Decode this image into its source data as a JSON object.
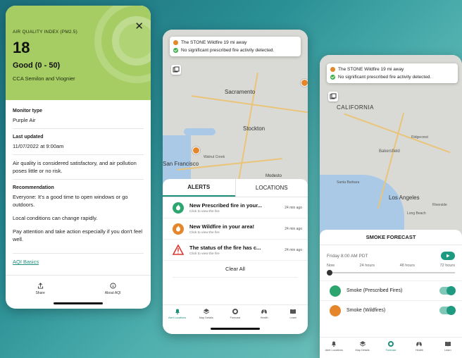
{
  "colors": {
    "aqi_good": "#a6cd64",
    "accent": "#1e8f7b",
    "fire": "#e6862a",
    "ok": "#3cae4a",
    "warning": "#d9382f"
  },
  "aqi_screen": {
    "index_label": "AIR QUALITY INDEX (PM2.5)",
    "value": "18",
    "status": "Good (0 - 50)",
    "station": "CCA Semilon and Viognier",
    "close_icon": "close-icon",
    "monitor_type_label": "Monitor type",
    "monitor_type_value": "Purple Air",
    "last_updated_label": "Last updated",
    "last_updated_value": "11/07/2022 at 9:00am",
    "description": "Air quality is considered satisfactory, and air pollution poses little or no risk.",
    "recommendation_label": "Recommendation",
    "recommendation_p1": "Everyone: It's a good time to open windows or go outdoors.",
    "recommendation_p2": "Local conditions can change rapidly.",
    "recommendation_p3": "Pay attention and take action especially if you don't feel well.",
    "aqi_basics_link": "AQI Basics",
    "footer": {
      "share_label": "Share",
      "about_label": "About AQI"
    }
  },
  "alerts_screen": {
    "banner_fire": "The STONE Wildfire 19 mi away",
    "banner_prescribed": "No significant prescribed fire activity detected.",
    "map_labels": {
      "sacramento": "Sacramento",
      "stockton": "Stockton",
      "san_francisco": "San Francisco",
      "modesto": "Modesto",
      "walnut_creek": "Walnut Creek"
    },
    "tabs": {
      "alerts": "ALERTS",
      "locations": "LOCATIONS"
    },
    "alerts": [
      {
        "title": "New Prescribed fire in your...",
        "subtitle": "Click to view the fire",
        "time": "24 min ago",
        "icon": "prescribed-fire-icon"
      },
      {
        "title": "New Wildfire in your area!",
        "subtitle": "Click to view the fire",
        "time": "24 min ago",
        "icon": "wildfire-icon"
      },
      {
        "title": "The status of the fire has c...",
        "subtitle": "Click to view the fire",
        "time": "24 min ago",
        "icon": "warning-icon"
      }
    ],
    "clear_all": "Clear All",
    "nav": [
      "Alert Locations",
      "Map Details",
      "Forecast",
      "Health",
      "Learn"
    ]
  },
  "forecast_screen": {
    "banner_fire": "The STONE Wildfire 19 mi away",
    "banner_prescribed": "No significant prescribed fire activity detected.",
    "map_labels": {
      "california": "CALIFORNIA",
      "bakersfield": "Bakersfield",
      "ridgecrest": "Ridgecrest",
      "los_angeles": "Los Angeles",
      "riverside": "Riverside",
      "long_beach": "Long Beach",
      "santa_barbara": "Santa Barbara"
    },
    "title": "SMOKE FORECAST",
    "date": "Friday 8:00 AM PDT",
    "slider_labels": [
      "Now",
      "24 hours",
      "48 hours",
      "72 hours"
    ],
    "slider_position": 0,
    "layers": [
      {
        "name": "Smoke (Prescribed Fires)",
        "enabled": true
      },
      {
        "name": "Smoke (Wildfires)",
        "enabled": true
      }
    ],
    "nav": [
      "Alert Locations",
      "Map Details",
      "Forecast",
      "Health",
      "Learn"
    ]
  }
}
